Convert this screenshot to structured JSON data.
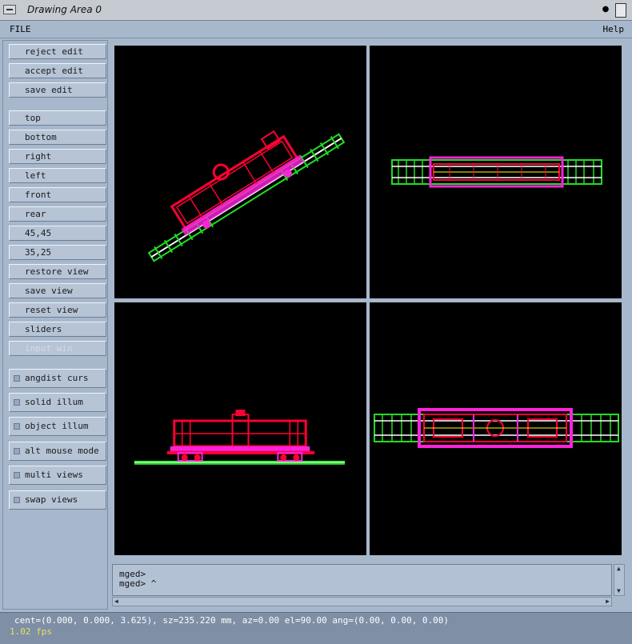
{
  "window": {
    "title": "Drawing Area 0"
  },
  "menubar": {
    "file": "FILE",
    "help": "Help"
  },
  "edit_buttons": [
    {
      "label": "reject edit"
    },
    {
      "label": "accept edit"
    },
    {
      "label": "save edit"
    }
  ],
  "view_buttons": [
    {
      "label": "top"
    },
    {
      "label": "bottom"
    },
    {
      "label": "right"
    },
    {
      "label": "left"
    },
    {
      "label": "front"
    },
    {
      "label": "rear"
    },
    {
      "label": "45,45"
    },
    {
      "label": "35,25"
    },
    {
      "label": "restore view"
    },
    {
      "label": "save view"
    },
    {
      "label": "reset view"
    },
    {
      "label": "sliders"
    },
    {
      "label": "input win",
      "disabled": true
    }
  ],
  "toggles": [
    {
      "label": "angdist curs"
    },
    {
      "label": "solid illum"
    },
    {
      "label": "object illum"
    },
    {
      "label": "alt mouse mode"
    },
    {
      "label": "multi views"
    },
    {
      "label": "swap views"
    }
  ],
  "command": {
    "line1": "mged>",
    "line2": "mged>"
  },
  "status": {
    "line1": "cent=(0.000, 0.000, 3.625), sz=235.220 mm, az=0.00 el=90.00 ang=(0.00, 0.00, 0.00)",
    "line2": "1.02 fps"
  },
  "colors": {
    "track": "#22dd22",
    "car": "#ff0033",
    "frame": "#ff22dd",
    "detail": "#ffff00",
    "background": "#000000"
  }
}
